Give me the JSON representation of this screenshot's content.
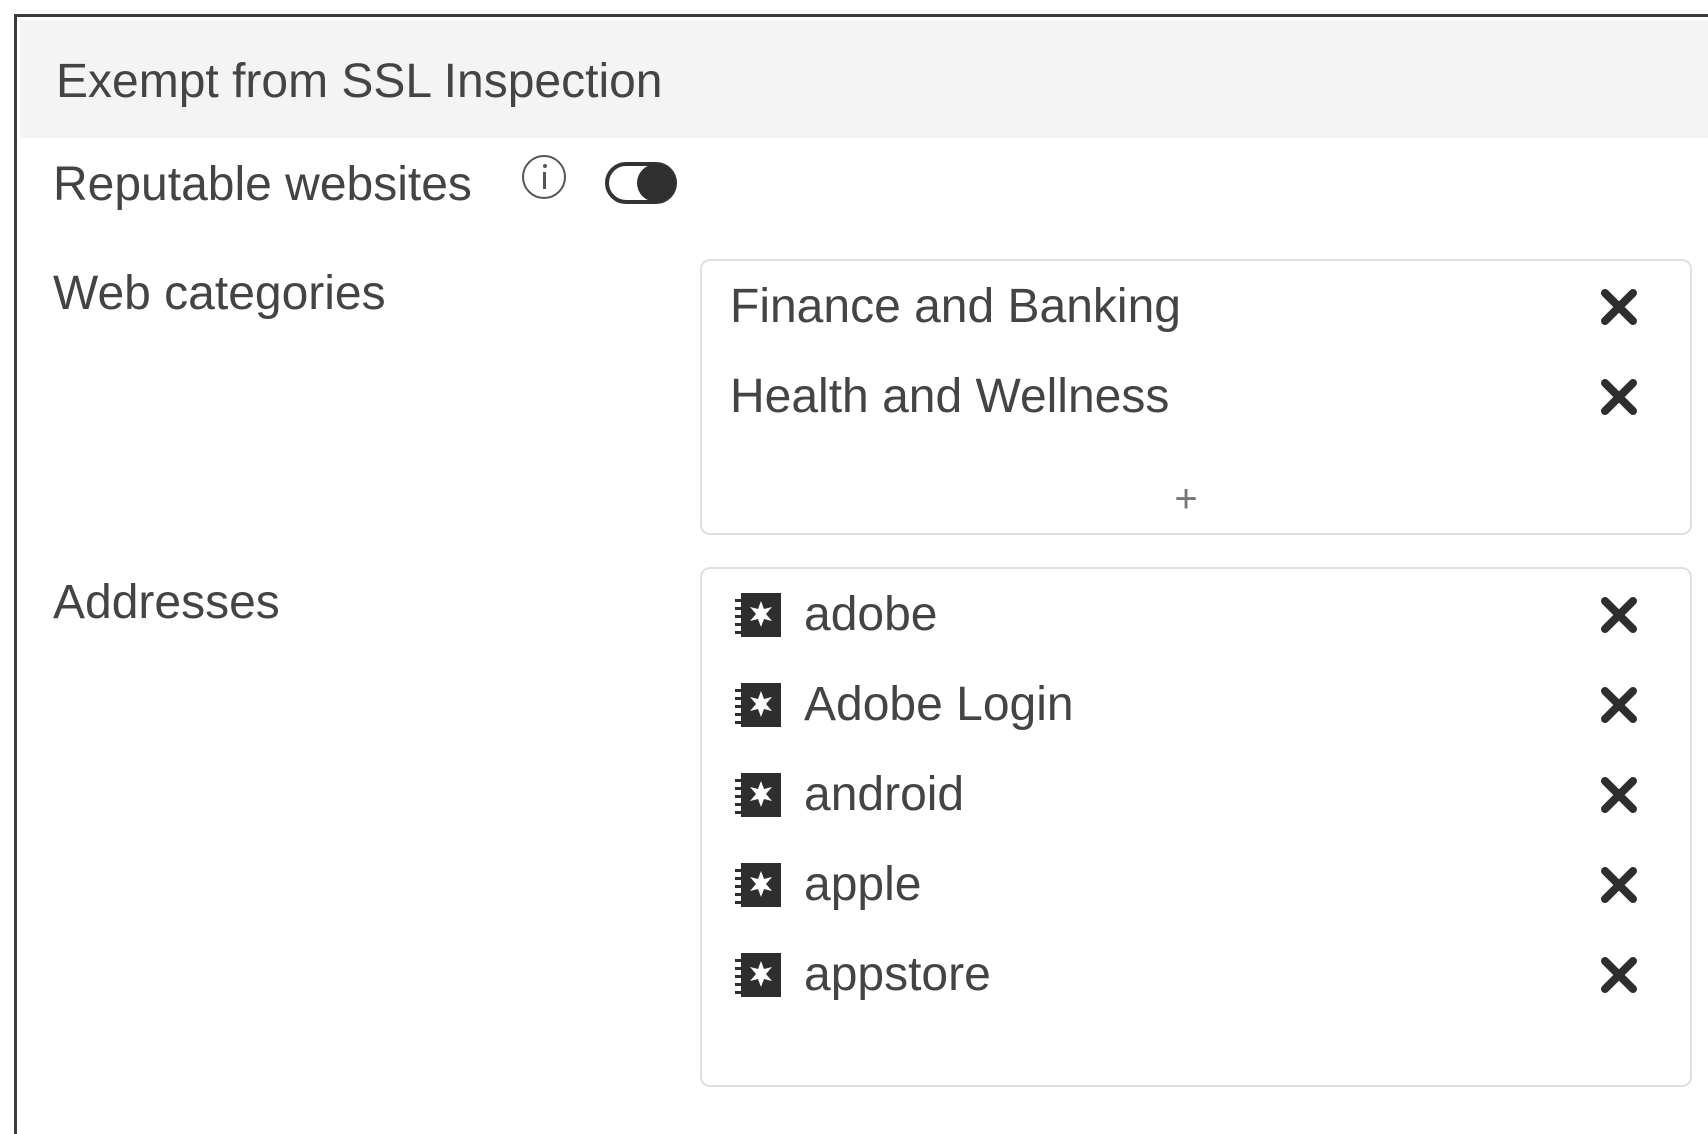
{
  "section": {
    "title": "Exempt from SSL Inspection"
  },
  "reputable_websites": {
    "label": "Reputable websites",
    "info_icon": "info-circle-icon",
    "toggle_state": "off"
  },
  "web_categories": {
    "label": "Web categories",
    "items": [
      {
        "label": "Finance and Banking",
        "remove_icon": "close-icon"
      },
      {
        "label": "Health and Wellness",
        "remove_icon": "close-icon"
      }
    ],
    "add_label": "+"
  },
  "addresses": {
    "label": "Addresses",
    "item_icon": "address-object-icon",
    "items": [
      {
        "label": "adobe",
        "remove_icon": "close-icon"
      },
      {
        "label": "Adobe Login",
        "remove_icon": "close-icon"
      },
      {
        "label": "android",
        "remove_icon": "close-icon"
      },
      {
        "label": "apple",
        "remove_icon": "close-icon"
      },
      {
        "label": "appstore",
        "remove_icon": "close-icon"
      }
    ]
  }
}
